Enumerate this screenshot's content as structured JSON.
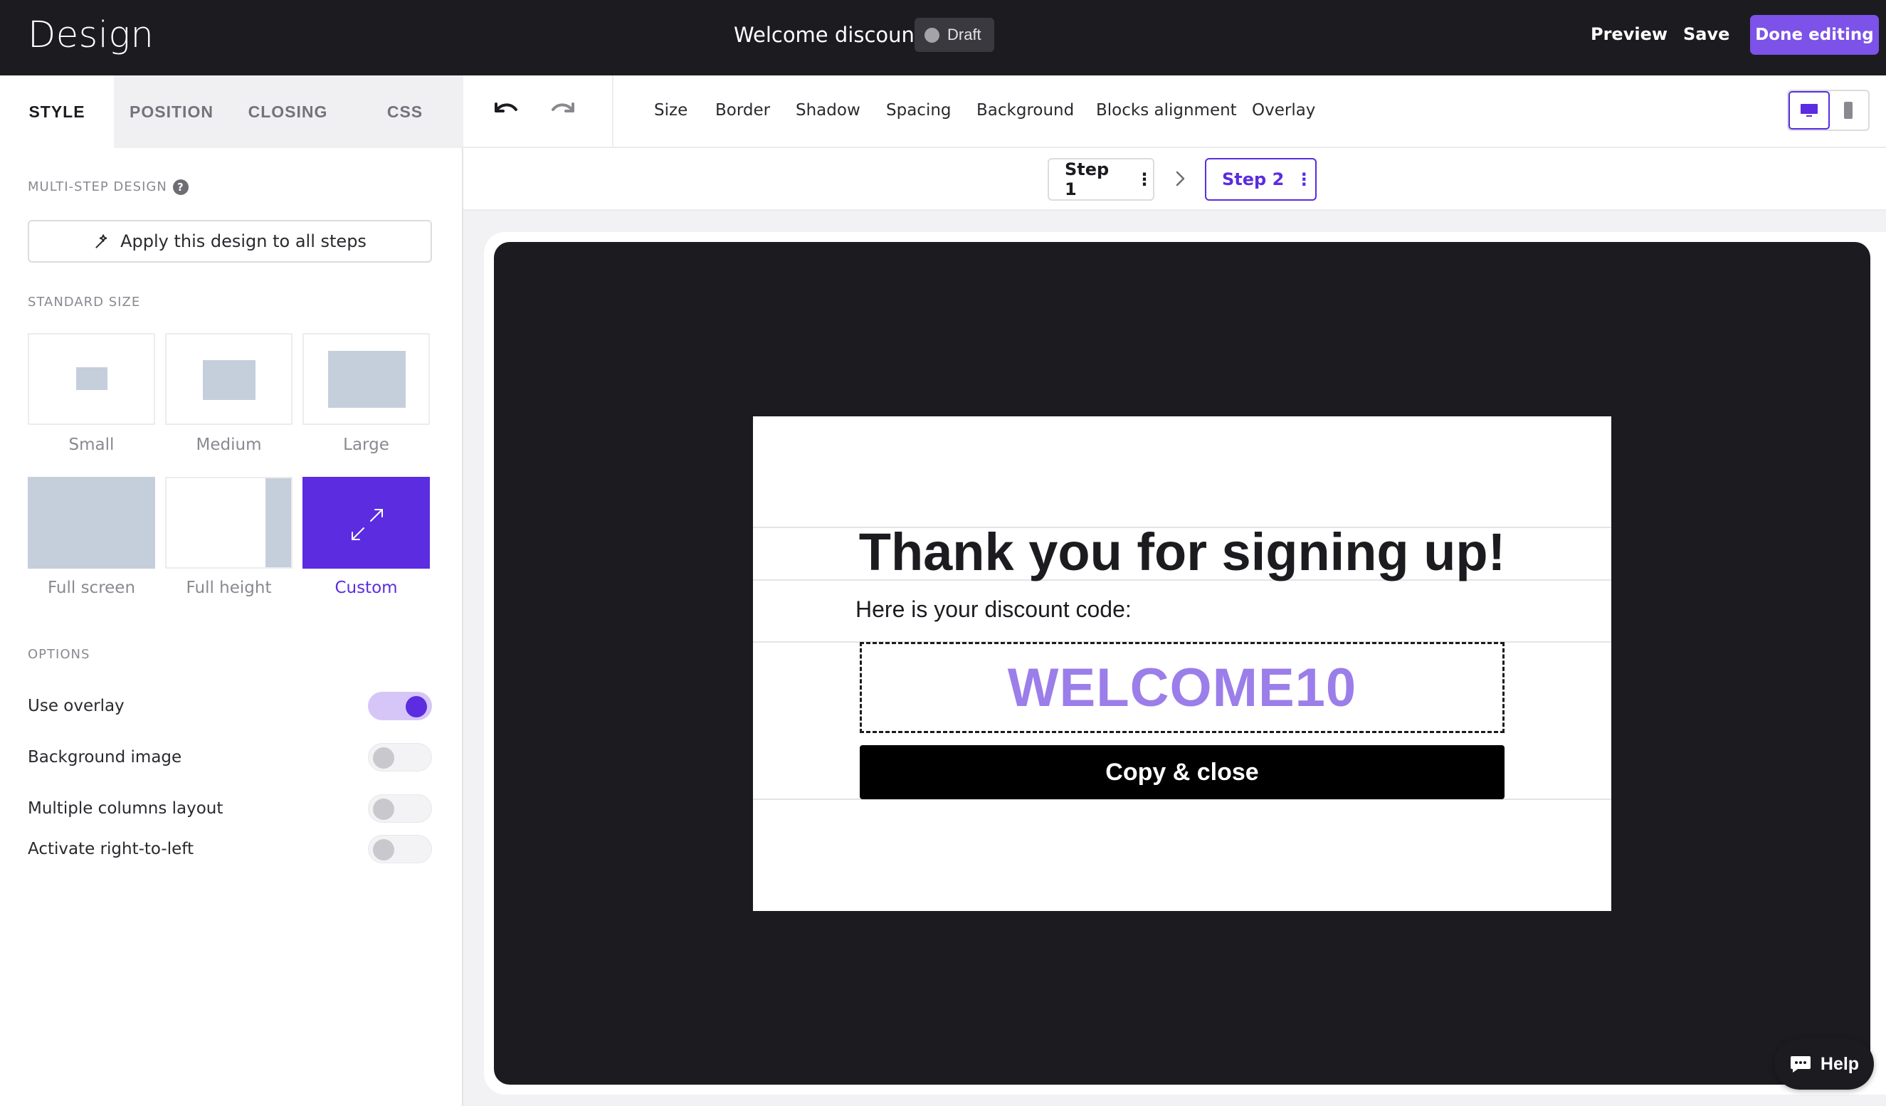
{
  "topbar": {
    "app_title": "Design",
    "doc_title": "Welcome discount",
    "status": "Draft",
    "preview": "Preview",
    "save": "Save",
    "done": "Done editing"
  },
  "tabs": [
    "STYLE",
    "POSITION",
    "CLOSING",
    "CSS"
  ],
  "left": {
    "multistep_label": "MULTI-STEP DESIGN",
    "apply_all": "Apply this design to all steps",
    "standard_size_label": "STANDARD SIZE",
    "sizes": [
      "Small",
      "Medium",
      "Large",
      "Full screen",
      "Full height",
      "Custom"
    ],
    "selected_size": "Custom",
    "options_label": "OPTIONS",
    "options": [
      {
        "label": "Use overlay",
        "on": true
      },
      {
        "label": "Background image",
        "on": false
      },
      {
        "label": "Multiple columns layout",
        "on": false
      },
      {
        "label": "Activate right-to-left",
        "on": false
      }
    ]
  },
  "toolbar": {
    "items": [
      "Size",
      "Border",
      "Shadow",
      "Spacing",
      "Background",
      "Blocks alignment",
      "Overlay"
    ]
  },
  "steps": {
    "step1": "Step 1",
    "step2": "Step 2",
    "active": "Step 2"
  },
  "popup": {
    "title": "Thank you for signing up!",
    "subtitle": "Here is your discount code:",
    "code": "WELCOME10",
    "button": "Copy & close"
  },
  "help": "Help",
  "colors": {
    "accent": "#5b2ce0",
    "done_button": "#7c52e8",
    "topbar": "#1c1b20",
    "code_text": "#9b7ee9"
  }
}
